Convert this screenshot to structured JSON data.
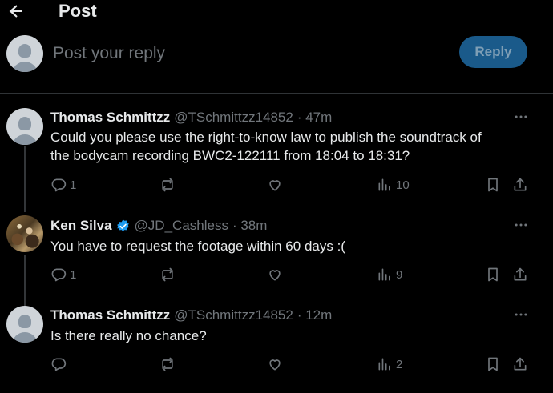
{
  "header": {
    "title": "Post"
  },
  "compose": {
    "placeholder": "Post your reply",
    "reply_label": "Reply"
  },
  "posts": [
    {
      "name": "Thomas Schmittzz",
      "handle": "@TSchmittzz14852",
      "time": "· 47m",
      "text_line1": "Could you please use the right-to-know law to publish the soundtrack of",
      "text_line2": "the bodycam recording BWC2-122111 from 18:04 to 18:31?",
      "replies": "1",
      "views": "10"
    },
    {
      "name": "Ken Silva",
      "handle": "@JD_Cashless",
      "time": "· 38m",
      "text_line1": "You have to request the footage within 60 days :(",
      "replies": "1",
      "views": "9"
    },
    {
      "name": "Thomas Schmittzz",
      "handle": "@TSchmittzz14852",
      "time": "· 12m",
      "text_line1": "Is there really no chance?",
      "replies": "",
      "views": "2"
    }
  ],
  "colors": {
    "accent": "#1d9bf0",
    "muted": "#71767b",
    "text": "#e7e9ea",
    "background": "#000000"
  }
}
